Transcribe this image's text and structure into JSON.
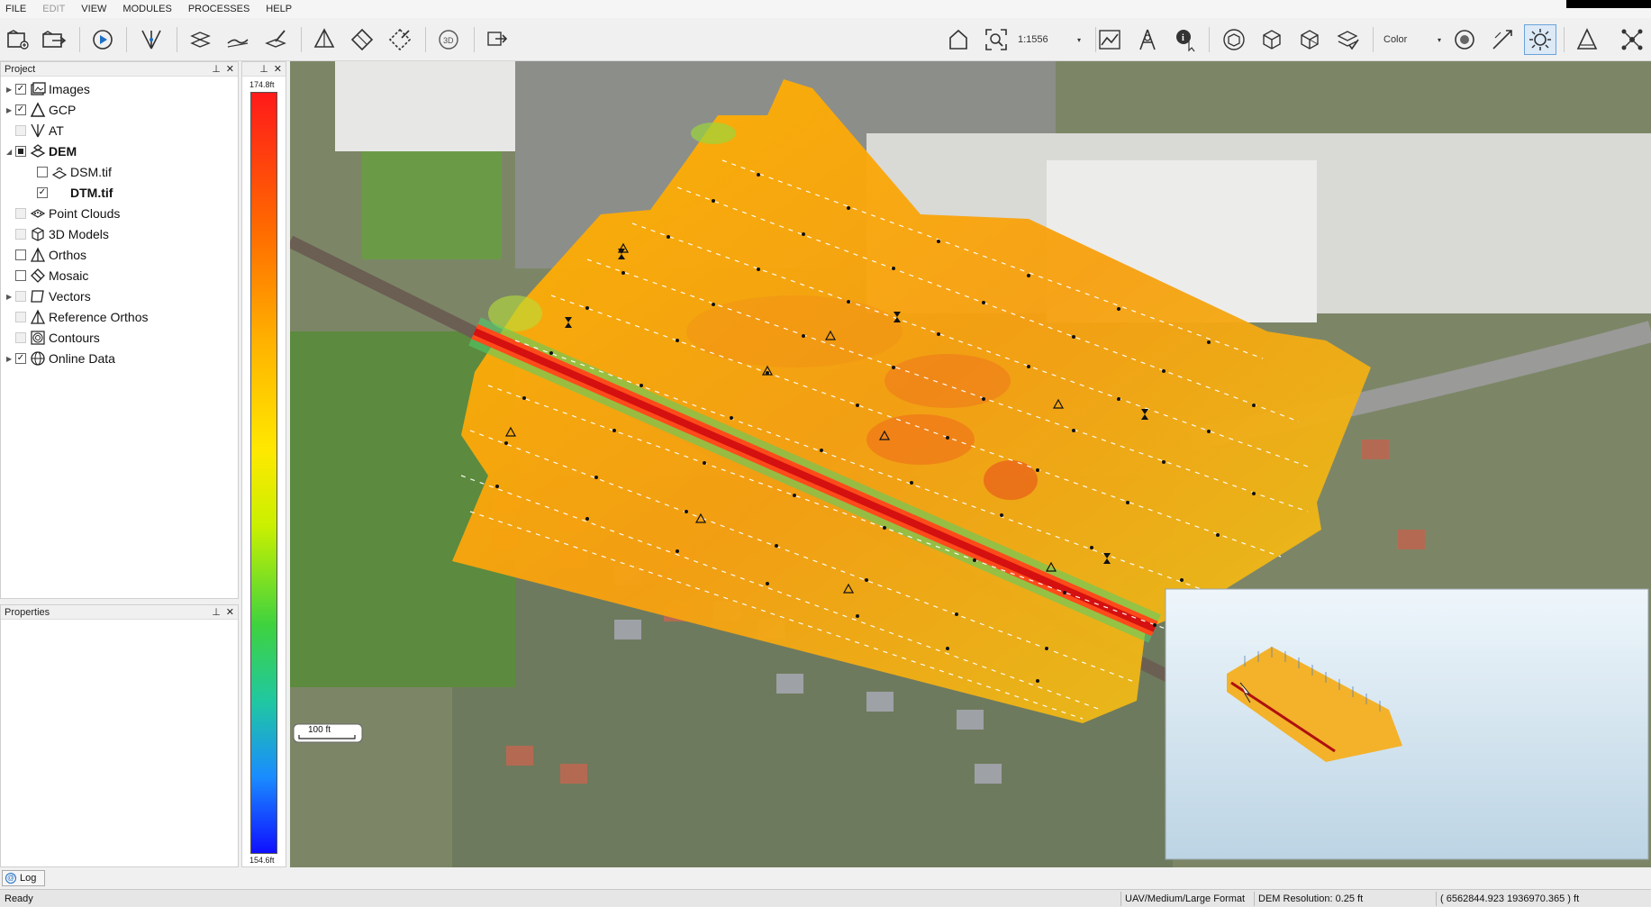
{
  "menu": {
    "file": "FILE",
    "edit": "EDIT",
    "view": "VIEW",
    "modules": "MODULES",
    "processes": "PROCESSES",
    "help": "HELP"
  },
  "toolbar": {
    "scale": "1:1556",
    "color_mode": "Color"
  },
  "project_panel": {
    "title": "Project",
    "items": [
      {
        "label": "Images",
        "checked": true
      },
      {
        "label": "GCP",
        "checked": true
      },
      {
        "label": "AT",
        "checked": false
      },
      {
        "label": "DEM",
        "checked": "partial"
      },
      {
        "label": "DSM.tif",
        "checked": false
      },
      {
        "label": "DTM.tif",
        "checked": true
      },
      {
        "label": "Point Clouds",
        "checked": false
      },
      {
        "label": "3D Models",
        "checked": false
      },
      {
        "label": "Orthos",
        "checked": false
      },
      {
        "label": "Mosaic",
        "checked": false
      },
      {
        "label": "Vectors",
        "checked": false
      },
      {
        "label": "Reference Orthos",
        "checked": false
      },
      {
        "label": "Contours",
        "checked": false
      },
      {
        "label": "Online Data",
        "checked": true
      }
    ]
  },
  "properties_panel": {
    "title": "Properties"
  },
  "elevation_ramp": {
    "max": "174.8ft",
    "min": "154.6ft"
  },
  "map": {
    "scale_bar": "100 ft"
  },
  "log_tab": "Log",
  "status": {
    "ready": "Ready",
    "format": "UAV/Medium/Large Format",
    "dem_resolution": "DEM Resolution: 0.25 ft",
    "coords": "( 6562844.923 1936970.365 ) ft"
  },
  "colors": {
    "accent": "#6aa3d9",
    "dem_high": "#ff1a1a",
    "dem_low": "#1010ff"
  }
}
